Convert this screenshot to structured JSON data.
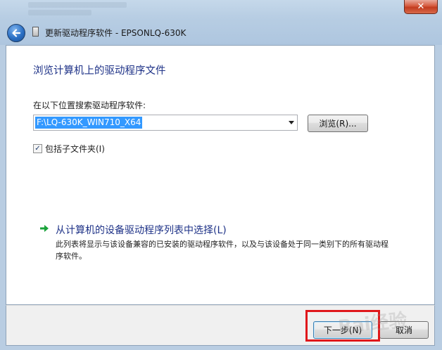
{
  "window": {
    "title": "更新驱动程序软件 - EPSONLQ-630K",
    "close_glyph": "✕"
  },
  "content": {
    "heading": "浏览计算机上的驱动程序文件",
    "search_label": "在以下位置搜索驱动程序软件:",
    "path_value": "F:\\LQ-630K_WIN710_X64",
    "browse_label": "浏览(R)...",
    "include_subfolders_label": "包括子文件夹(I)",
    "include_subfolders_checked": true,
    "pick_link_title": "从计算机的设备驱动程序列表中选择(L)",
    "pick_link_desc": "此列表将显示与该设备兼容的已安装的驱动程序软件，以及与该设备处于同一类别下的所有驱动程序软件。"
  },
  "footer": {
    "next_label": "下一步(N)",
    "cancel_label": "取消"
  },
  "watermark": "Bai经验",
  "icons": {
    "back": "back-arrow-icon",
    "device": "device-icon",
    "link": "green-arrow-icon"
  },
  "colors": {
    "heading": "#1e3287",
    "selection": "#3399ff",
    "highlight_box": "#e0171b",
    "link_arrow": "#1aa33b"
  }
}
